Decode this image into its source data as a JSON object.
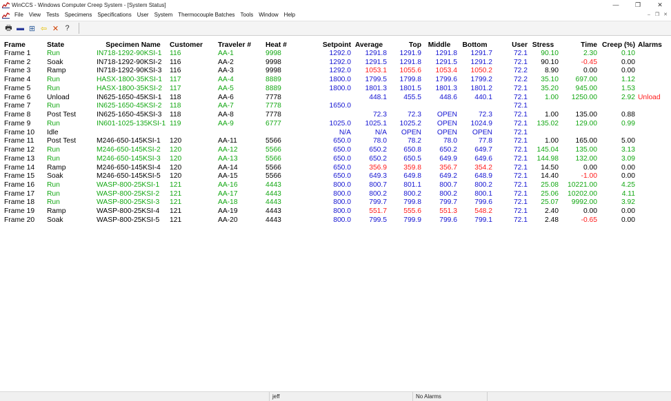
{
  "window": {
    "title": "WinCCS - Windows Computer Creep System - [System Status]"
  },
  "menu": [
    "File",
    "View",
    "Tests",
    "Specimens",
    "Specifications",
    "User",
    "System",
    "Thermocouple Batches",
    "Tools",
    "Window",
    "Help"
  ],
  "toolbar": [
    {
      "name": "print-icon",
      "glyph": "🖶",
      "color": "#333"
    },
    {
      "name": "monitor-icon",
      "glyph": "▬",
      "color": "#2a3a9a"
    },
    {
      "name": "table-icon",
      "glyph": "⊞",
      "color": "#2a5a9a"
    },
    {
      "name": "back-arrow-icon",
      "glyph": "⇦",
      "color": "#e8c000"
    },
    {
      "name": "delete-icon",
      "glyph": "✕",
      "color": "#d04000"
    },
    {
      "name": "help-icon",
      "glyph": "?",
      "color": "#333"
    }
  ],
  "colors": {
    "green": "#12a712",
    "black": "#000000",
    "blue": "#1414d2",
    "red": "#ff1a1a"
  },
  "table": {
    "headers": [
      "Frame",
      "State",
      "Specimen Name",
      "Customer",
      "Traveler #",
      "Heat #",
      "Setpoint",
      "Average",
      "Top",
      "Middle",
      "Bottom",
      "User",
      "Stress",
      "Time",
      "Creep (%)",
      "Alarms"
    ],
    "rows": [
      {
        "frame": "Frame 1",
        "state": "Run",
        "specimen": "IN718-1292-90KSI-1",
        "customer": "116",
        "traveler": "AA-1",
        "heat": "9998",
        "setpoint": "1292.0",
        "average": "1291.8",
        "top": "1291.9",
        "middle": "1291.8",
        "bottom": "1291.7",
        "user": "72.1",
        "stress": "90.10",
        "time": "2.30",
        "creep": "0.10",
        "alarm": ""
      },
      {
        "frame": "Frame 2",
        "state": "Soak",
        "specimen": "IN718-1292-90KSI-2",
        "customer": "116",
        "traveler": "AA-2",
        "heat": "9998",
        "setpoint": "1292.0",
        "average": "1291.5",
        "top": "1291.8",
        "middle": "1291.5",
        "bottom": "1291.2",
        "user": "72.1",
        "stress": "90.10",
        "time": "-0.45",
        "creep": "0.00",
        "alarm": ""
      },
      {
        "frame": "Frame 3",
        "state": "Ramp",
        "specimen": "IN718-1292-90KSI-3",
        "customer": "116",
        "traveler": "AA-3",
        "heat": "9998",
        "setpoint": "1292.0",
        "average": "1053.1",
        "top": "1055.6",
        "middle": "1053.4",
        "bottom": "1050.2",
        "user": "72.2",
        "stress": "8.90",
        "time": "0.00",
        "creep": "0.00",
        "alarm": ""
      },
      {
        "frame": "Frame 4",
        "state": "Run",
        "specimen": "HASX-1800-35KSI-1",
        "customer": "117",
        "traveler": "AA-4",
        "heat": "8889",
        "setpoint": "1800.0",
        "average": "1799.5",
        "top": "1799.8",
        "middle": "1799.6",
        "bottom": "1799.2",
        "user": "72.2",
        "stress": "35.10",
        "time": "697.00",
        "creep": "1.12",
        "alarm": ""
      },
      {
        "frame": "Frame 5",
        "state": "Run",
        "specimen": "HASX-1800-35KSI-2",
        "customer": "117",
        "traveler": "AA-5",
        "heat": "8889",
        "setpoint": "1800.0",
        "average": "1801.3",
        "top": "1801.5",
        "middle": "1801.3",
        "bottom": "1801.2",
        "user": "72.1",
        "stress": "35.20",
        "time": "945.00",
        "creep": "1.53",
        "alarm": ""
      },
      {
        "frame": "Frame 6",
        "state": "Unload",
        "specimen": "IN625-1650-45KSI-1",
        "customer": "118",
        "traveler": "AA-6",
        "heat": "7778",
        "setpoint": "",
        "average": "448.1",
        "top": "455.5",
        "middle": "448.6",
        "bottom": "440.1",
        "user": "72.1",
        "stress": "1.00",
        "time": "1250.00",
        "creep": "2.92",
        "alarm": "Unload"
      },
      {
        "frame": "Frame 7",
        "state": "Run",
        "specimen": "IN625-1650-45KSI-2",
        "customer": "118",
        "traveler": "AA-7",
        "heat": "7778",
        "setpoint": "1650.0",
        "average": "",
        "top": "",
        "middle": "",
        "bottom": "",
        "user": "72.1",
        "stress": "",
        "time": "",
        "creep": "",
        "alarm": ""
      },
      {
        "frame": "Frame 8",
        "state": "Post Test",
        "specimen": "IN625-1650-45KSI-3",
        "customer": "118",
        "traveler": "AA-8",
        "heat": "7778",
        "setpoint": "",
        "average": "72.3",
        "top": "72.3",
        "middle": "OPEN",
        "bottom": "72.3",
        "user": "72.1",
        "stress": "1.00",
        "time": "135.00",
        "creep": "0.88",
        "alarm": ""
      },
      {
        "frame": "Frame 9",
        "state": "Run",
        "specimen": "IN601-1025-135KSI-1",
        "customer": "119",
        "traveler": "AA-9",
        "heat": "6777",
        "setpoint": "1025.0",
        "average": "1025.1",
        "top": "1025.2",
        "middle": "OPEN",
        "bottom": "1024.9",
        "user": "72.1",
        "stress": "135.02",
        "time": "129.00",
        "creep": "0.99",
        "alarm": ""
      },
      {
        "frame": "Frame 10",
        "state": "Idle",
        "specimen": "",
        "customer": "",
        "traveler": "",
        "heat": "",
        "setpoint": "N/A",
        "average": "N/A",
        "top": "OPEN",
        "middle": "OPEN",
        "bottom": "OPEN",
        "user": "72.1",
        "stress": "",
        "time": "",
        "creep": "",
        "alarm": ""
      },
      {
        "frame": "Frame 11",
        "state": "Post Test",
        "specimen": "M246-650-145KSI-1",
        "customer": "120",
        "traveler": "AA-11",
        "heat": "5566",
        "setpoint": "650.0",
        "average": "78.0",
        "top": "78.2",
        "middle": "78.0",
        "bottom": "77.8",
        "user": "72.1",
        "stress": "1.00",
        "time": "165.00",
        "creep": "5.00",
        "alarm": ""
      },
      {
        "frame": "Frame 12",
        "state": "Run",
        "specimen": "M246-650-145KSI-2",
        "customer": "120",
        "traveler": "AA-12",
        "heat": "5566",
        "setpoint": "650.0",
        "average": "650.2",
        "top": "650.8",
        "middle": "650.2",
        "bottom": "649.7",
        "user": "72.1",
        "stress": "145.04",
        "time": "135.00",
        "creep": "3.13",
        "alarm": ""
      },
      {
        "frame": "Frame 13",
        "state": "Run",
        "specimen": "M246-650-145KSI-3",
        "customer": "120",
        "traveler": "AA-13",
        "heat": "5566",
        "setpoint": "650.0",
        "average": "650.2",
        "top": "650.5",
        "middle": "649.9",
        "bottom": "649.6",
        "user": "72.1",
        "stress": "144.98",
        "time": "132.00",
        "creep": "3.09",
        "alarm": ""
      },
      {
        "frame": "Frame 14",
        "state": "Ramp",
        "specimen": "M246-650-145KSI-4",
        "customer": "120",
        "traveler": "AA-14",
        "heat": "5566",
        "setpoint": "650.0",
        "average": "356.9",
        "top": "359.8",
        "middle": "356.7",
        "bottom": "354.2",
        "user": "72.1",
        "stress": "14.50",
        "time": "0.00",
        "creep": "0.00",
        "alarm": ""
      },
      {
        "frame": "Frame 15",
        "state": "Soak",
        "specimen": "M246-650-145KSI-5",
        "customer": "120",
        "traveler": "AA-15",
        "heat": "5566",
        "setpoint": "650.0",
        "average": "649.3",
        "top": "649.8",
        "middle": "649.2",
        "bottom": "648.9",
        "user": "72.1",
        "stress": "14.40",
        "time": "-1.00",
        "creep": "0.00",
        "alarm": ""
      },
      {
        "frame": "Frame 16",
        "state": "Run",
        "specimen": "WASP-800-25KSI-1",
        "customer": "121",
        "traveler": "AA-16",
        "heat": "4443",
        "setpoint": "800.0",
        "average": "800.7",
        "top": "801.1",
        "middle": "800.7",
        "bottom": "800.2",
        "user": "72.1",
        "stress": "25.08",
        "time": "10221.00",
        "creep": "4.25",
        "alarm": ""
      },
      {
        "frame": "Frame 17",
        "state": "Run",
        "specimen": "WASP-800-25KSI-2",
        "customer": "121",
        "traveler": "AA-17",
        "heat": "4443",
        "setpoint": "800.0",
        "average": "800.2",
        "top": "800.2",
        "middle": "800.2",
        "bottom": "800.1",
        "user": "72.1",
        "stress": "25.06",
        "time": "10202.00",
        "creep": "4.11",
        "alarm": ""
      },
      {
        "frame": "Frame 18",
        "state": "Run",
        "specimen": "WASP-800-25KSI-3",
        "customer": "121",
        "traveler": "AA-18",
        "heat": "4443",
        "setpoint": "800.0",
        "average": "799.7",
        "top": "799.8",
        "middle": "799.7",
        "bottom": "799.6",
        "user": "72.1",
        "stress": "25.07",
        "time": "9992.00",
        "creep": "3.92",
        "alarm": ""
      },
      {
        "frame": "Frame 19",
        "state": "Ramp",
        "specimen": "WASP-800-25KSI-4",
        "customer": "121",
        "traveler": "AA-19",
        "heat": "4443",
        "setpoint": "800.0",
        "average": "551.7",
        "top": "555.6",
        "middle": "551.3",
        "bottom": "548.2",
        "user": "72.1",
        "stress": "2.40",
        "time": "0.00",
        "creep": "0.00",
        "alarm": ""
      },
      {
        "frame": "Frame 20",
        "state": "Soak",
        "specimen": "WASP-800-25KSI-5",
        "customer": "121",
        "traveler": "AA-20",
        "heat": "4443",
        "setpoint": "800.0",
        "average": "799.5",
        "top": "799.9",
        "middle": "799.6",
        "bottom": "799.1",
        "user": "72.1",
        "stress": "2.48",
        "time": "-0.65",
        "creep": "0.00",
        "alarm": ""
      }
    ]
  },
  "statusbar": {
    "user": "jeff",
    "alarms": "No Alarms"
  }
}
